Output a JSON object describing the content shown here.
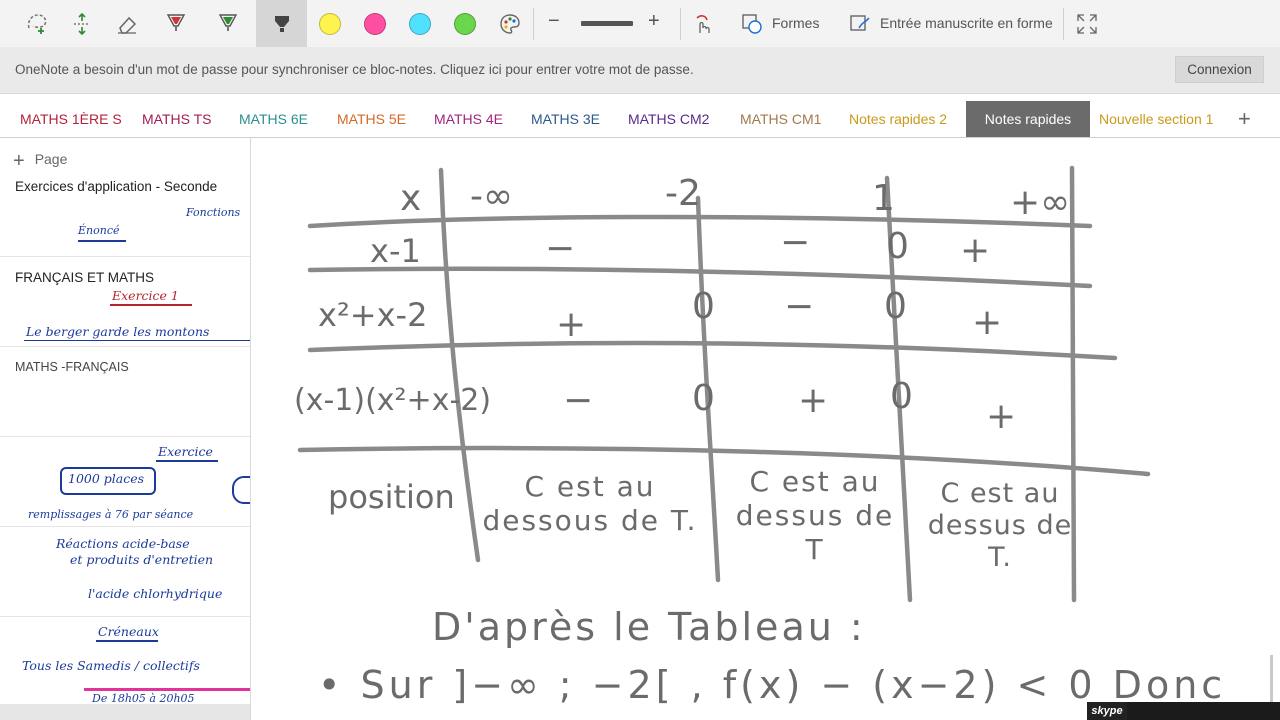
{
  "toolbar": {
    "tools": [
      {
        "name": "lasso-select-icon"
      },
      {
        "name": "insert-space-icon"
      },
      {
        "name": "eraser-icon"
      },
      {
        "name": "pen-red-icon",
        "color": "#d13438"
      },
      {
        "name": "pen-green-icon",
        "color": "#2e8b2e"
      },
      {
        "name": "highlighter-icon"
      }
    ],
    "colors": [
      "#fff44f",
      "#ff4fa3",
      "#4fe1ff",
      "#6bd64b"
    ],
    "palette_icon": "palette-icon",
    "zoom_out": "−",
    "zoom_in": "+",
    "touch_draw_icon": "touch-draw-icon",
    "shapes_label": "Formes",
    "ink_to_shape_label": "Entrée manuscrite en forme",
    "fullscreen_icon": "fullscreen-icon"
  },
  "notification": {
    "message": "OneNote a besoin d'un mot de passe pour synchroniser ce bloc-notes. Cliquez ici pour entrer votre mot de passe.",
    "button": "Connexion"
  },
  "sections": [
    {
      "label": "MATHS 1ÈRE S",
      "color": "#b4233c"
    },
    {
      "label": "MATHS TS",
      "color": "#a01e55"
    },
    {
      "label": "MATHS 6E",
      "color": "#2b8f8f"
    },
    {
      "label": "MATHS 5E",
      "color": "#d3682a"
    },
    {
      "label": "MATHS 4E",
      "color": "#a0257e"
    },
    {
      "label": "MATHS 3E",
      "color": "#2a5a8c"
    },
    {
      "label": "MATHS CM2",
      "color": "#5a2a8c"
    },
    {
      "label": "MATHS CM1",
      "color": "#a07a4a"
    },
    {
      "label": "Notes rapides 2",
      "color": "#c99a1a"
    },
    {
      "label": "Notes rapides",
      "color": "#ffffff",
      "active": true
    },
    {
      "label": "Nouvelle section 1",
      "color": "#c99a1a"
    }
  ],
  "add_section": "+",
  "pages": {
    "add_label": "Page",
    "items": [
      {
        "title": "Exercices d'application - Seconde",
        "hw": [
          "Fonctions",
          "Énoncé"
        ]
      },
      {
        "title": "FRANÇAIS ET MATHS",
        "hw": [
          "Exercice 1",
          "Le berger garde les montons"
        ]
      },
      {
        "title": "MATHS -FRANÇAIS",
        "hw": []
      },
      {
        "title": "",
        "hw": [
          "Exercice",
          "1000 places",
          "remplissages à 76 par séance"
        ]
      },
      {
        "title": "",
        "hw": [
          "Réactions acide-base",
          "et produits d'entretien",
          "l'acide chlorhydrique"
        ]
      },
      {
        "title": "",
        "hw": [
          "Créneaux",
          "Tous les Samedis / collectifs",
          "De 18h05 à 20h05"
        ]
      }
    ]
  },
  "note": {
    "header_row": [
      "x",
      "-∞",
      "-2",
      "1",
      "+∞"
    ],
    "rows": [
      {
        "label": "x-1",
        "cells": [
          "−",
          "−",
          "0",
          "+"
        ]
      },
      {
        "label": "x²+x-2",
        "cells": [
          "+",
          "0",
          "−",
          "0",
          "+"
        ]
      },
      {
        "label": "(x-1)(x²+x-2)",
        "cells": [
          "−",
          "0",
          "+",
          "0",
          "+"
        ]
      }
    ],
    "position_label": "position",
    "position_cells": [
      "C est au dessous de T.",
      "C est au dessus de T",
      "C est au dessus de T."
    ],
    "conclusion_title": "D'après le Tableau :",
    "conclusion_line": "• Sur ]−∞ ; −2[ , f(x) − (x−2) < 0 Donc"
  },
  "skype_label": "skype"
}
